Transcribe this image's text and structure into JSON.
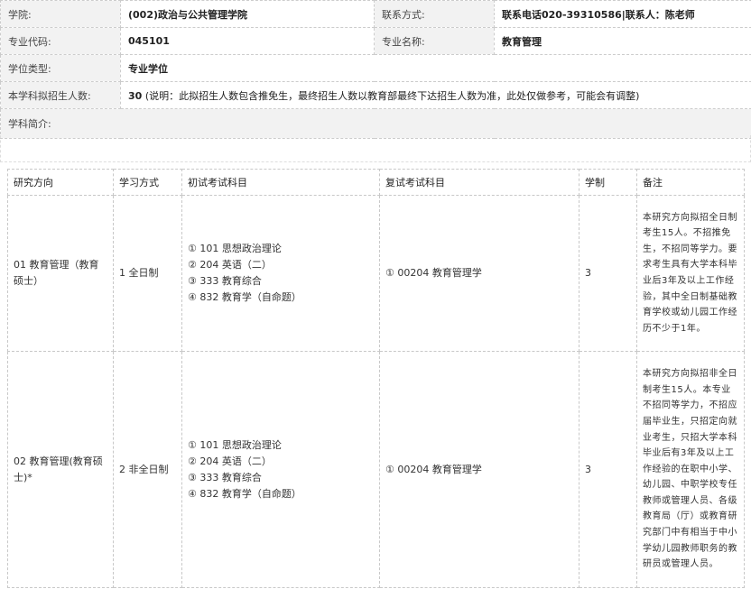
{
  "info": {
    "college_label": "学院:",
    "college_value": "(002)政治与公共管理学院",
    "contact_label": "联系方式:",
    "contact_value": "联系电话020-39310586|联系人：陈老师",
    "major_code_label": "专业代码:",
    "major_code_value": "045101",
    "major_name_label": "专业名称:",
    "major_name_value": "教育管理",
    "degree_type_label": "学位类型:",
    "degree_type_value": "专业学位",
    "enroll_label": "本学科拟招生人数:",
    "enroll_count": "30",
    "enroll_note": "(说明：此拟招生人数包含推免生，最终招生人数以教育部最终下达招生人数为准，此处仅做参考，可能会有调整)",
    "intro_label": "学科简介:"
  },
  "table": {
    "headers": [
      "研究方向",
      "学习方式",
      "初试考试科目",
      "复试考试科目",
      "学制",
      "备注"
    ],
    "rows": [
      {
        "direction": "01 教育管理（教育硕士）",
        "mode": "1 全日制",
        "exams": [
          "① 101 思想政治理论",
          "② 204 英语（二）",
          "③ 333 教育综合",
          "④ 832 教育学（自命题）"
        ],
        "retest": "① 00204 教育管理学",
        "years": "3",
        "note": "本研究方向拟招全日制考生15人。不招推免生，不招同等学力。要求考生具有大学本科毕业后3年及以上工作经验，其中全日制基础教育学校或幼儿园工作经历不少于1年。"
      },
      {
        "direction": "02 教育管理(教育硕士)*",
        "mode": "2 非全日制",
        "exams": [
          "① 101 思想政治理论",
          "② 204 英语（二）",
          "③ 333 教育综合",
          "④ 832 教育学（自命题）"
        ],
        "retest": "① 00204 教育管理学",
        "years": "3",
        "note": "本研究方向拟招非全日制考生15人。本专业不招同等学力，不招应届毕业生，只招定向就业考生，只招大学本科毕业后有3年及以上工作经验的在职中小学、幼儿园、中职学校专任教师或管理人员、各级教育局（厅）或教育研究部门中有相当于中小学幼儿园教师职务的教研员或管理人员。"
      }
    ]
  }
}
